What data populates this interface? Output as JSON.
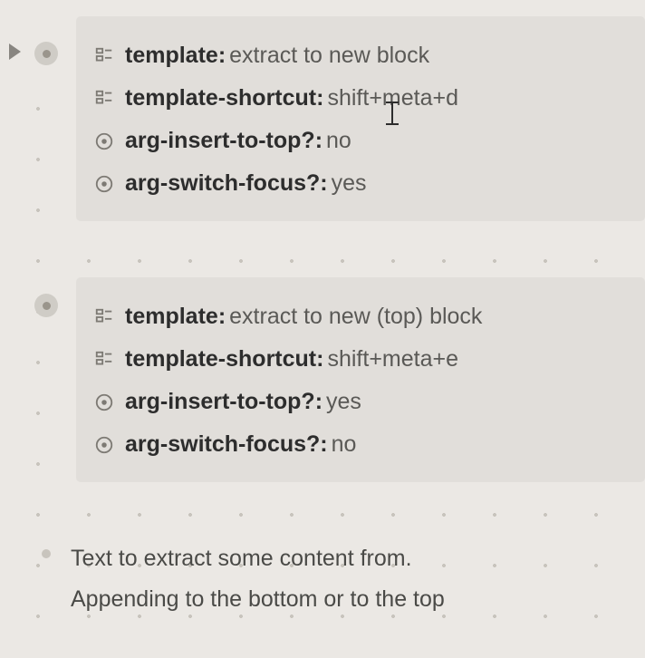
{
  "blocks": [
    {
      "rows": [
        {
          "icon": "template-icon",
          "key": "template",
          "value": "extract to new block"
        },
        {
          "icon": "template-icon",
          "key": "template-shortcut",
          "value": "shift+meta+d"
        },
        {
          "icon": "radio-icon",
          "key": "arg-insert-to-top?",
          "value": "no"
        },
        {
          "icon": "radio-icon",
          "key": "arg-switch-focus?",
          "value": "yes"
        }
      ]
    },
    {
      "rows": [
        {
          "icon": "template-icon",
          "key": "template",
          "value": "extract to new (top) block"
        },
        {
          "icon": "template-icon",
          "key": "template-shortcut",
          "value": "shift+meta+e"
        },
        {
          "icon": "radio-icon",
          "key": "arg-insert-to-top?",
          "value": "yes"
        },
        {
          "icon": "radio-icon",
          "key": "arg-switch-focus?",
          "value": "no"
        }
      ]
    }
  ],
  "text": {
    "line1": "Text to extract some content from.",
    "line2": "Appending to the bottom or to the top"
  }
}
